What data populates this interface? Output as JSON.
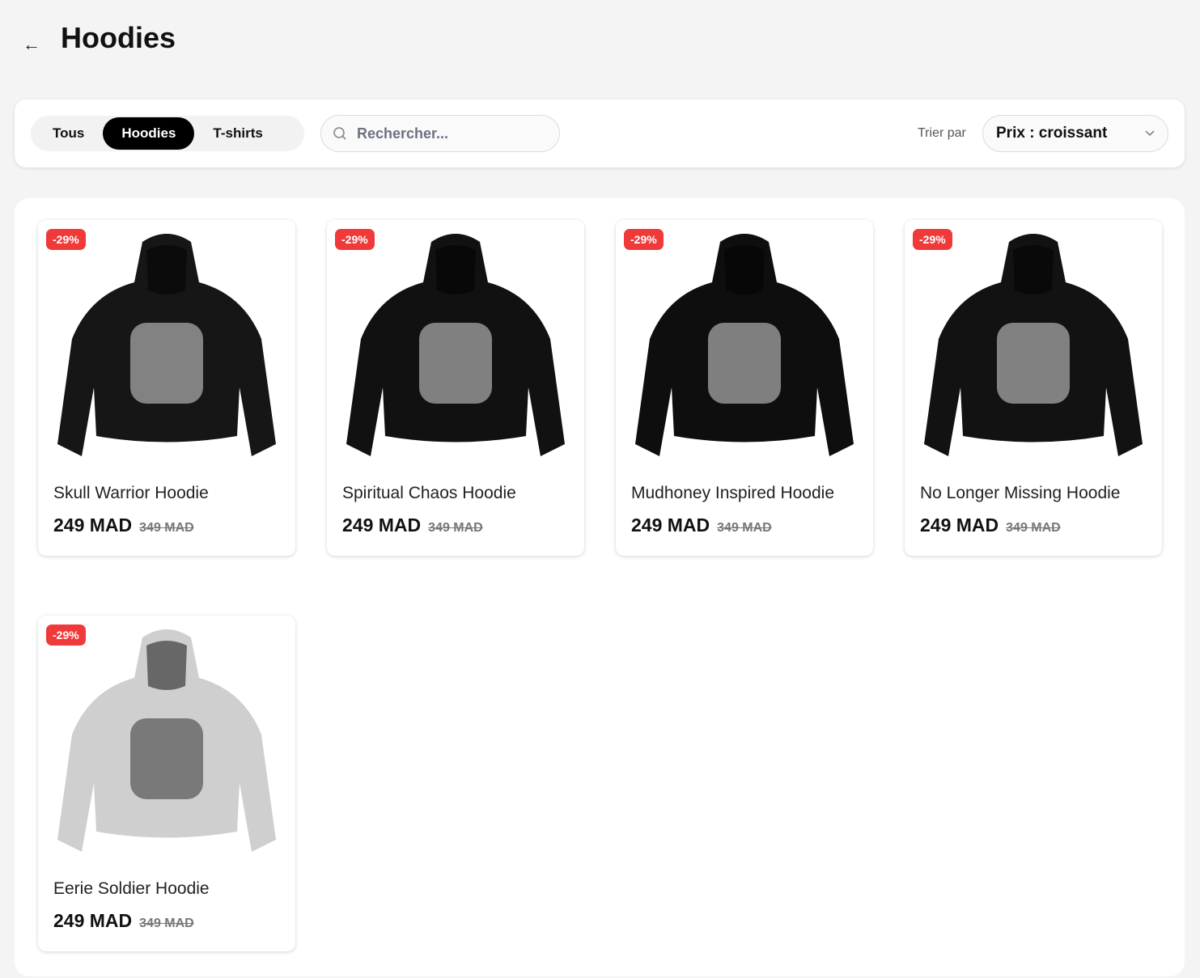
{
  "header": {
    "title": "Hoodies"
  },
  "filters": {
    "tabs": [
      {
        "label": "Tous"
      },
      {
        "label": "Hoodies"
      },
      {
        "label": "T-shirts"
      }
    ],
    "search_placeholder": "Rechercher...",
    "sort_label": "Trier par",
    "sort_value": "Prix : croissant"
  },
  "products": [
    {
      "name": "Skull Warrior Hoodie",
      "price": "249 MAD",
      "old_price": "349 MAD",
      "badge": "-29%",
      "color": "#161616"
    },
    {
      "name": "Spiritual Chaos Hoodie",
      "price": "249 MAD",
      "old_price": "349 MAD",
      "badge": "-29%",
      "color": "#111111"
    },
    {
      "name": "Mudhoney Inspired Hoodie",
      "price": "249 MAD",
      "old_price": "349 MAD",
      "badge": "-29%",
      "color": "#0e0e0e"
    },
    {
      "name": "No Longer Missing Hoodie",
      "price": "249 MAD",
      "old_price": "349 MAD",
      "badge": "-29%",
      "color": "#121212"
    },
    {
      "name": "Eerie Soldier Hoodie",
      "price": "249 MAD",
      "old_price": "349 MAD",
      "badge": "-29%",
      "color": "#cfcfcf"
    }
  ]
}
